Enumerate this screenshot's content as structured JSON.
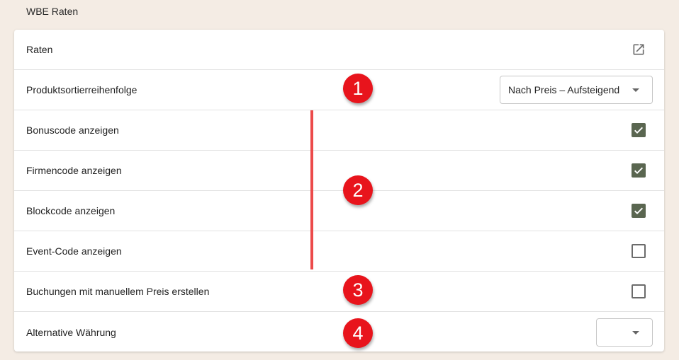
{
  "section": {
    "title": "WBE Raten"
  },
  "rows": {
    "rates": {
      "label": "Raten",
      "icon": "external-link-icon"
    },
    "sort_order": {
      "label": "Produktsortierreihenfolge",
      "value": "Nach Preis – Aufsteigend"
    },
    "bonus_code": {
      "label": "Bonuscode anzeigen",
      "checked": true
    },
    "company_code": {
      "label": "Firmencode anzeigen",
      "checked": true
    },
    "block_code": {
      "label": "Blockcode anzeigen",
      "checked": true
    },
    "event_code": {
      "label": "Event-Code anzeigen",
      "checked": false
    },
    "manual_price": {
      "label": "Buchungen mit manuellem Preis erstellen",
      "checked": false
    },
    "alt_currency": {
      "label": "Alternative Währung",
      "value": ""
    }
  },
  "annotations": {
    "b1": "1",
    "b2": "2",
    "b3": "3",
    "b4": "4"
  },
  "colors": {
    "background": "#f4ece4",
    "checkbox_checked": "#5a6650",
    "annotation": "#e8141c"
  }
}
